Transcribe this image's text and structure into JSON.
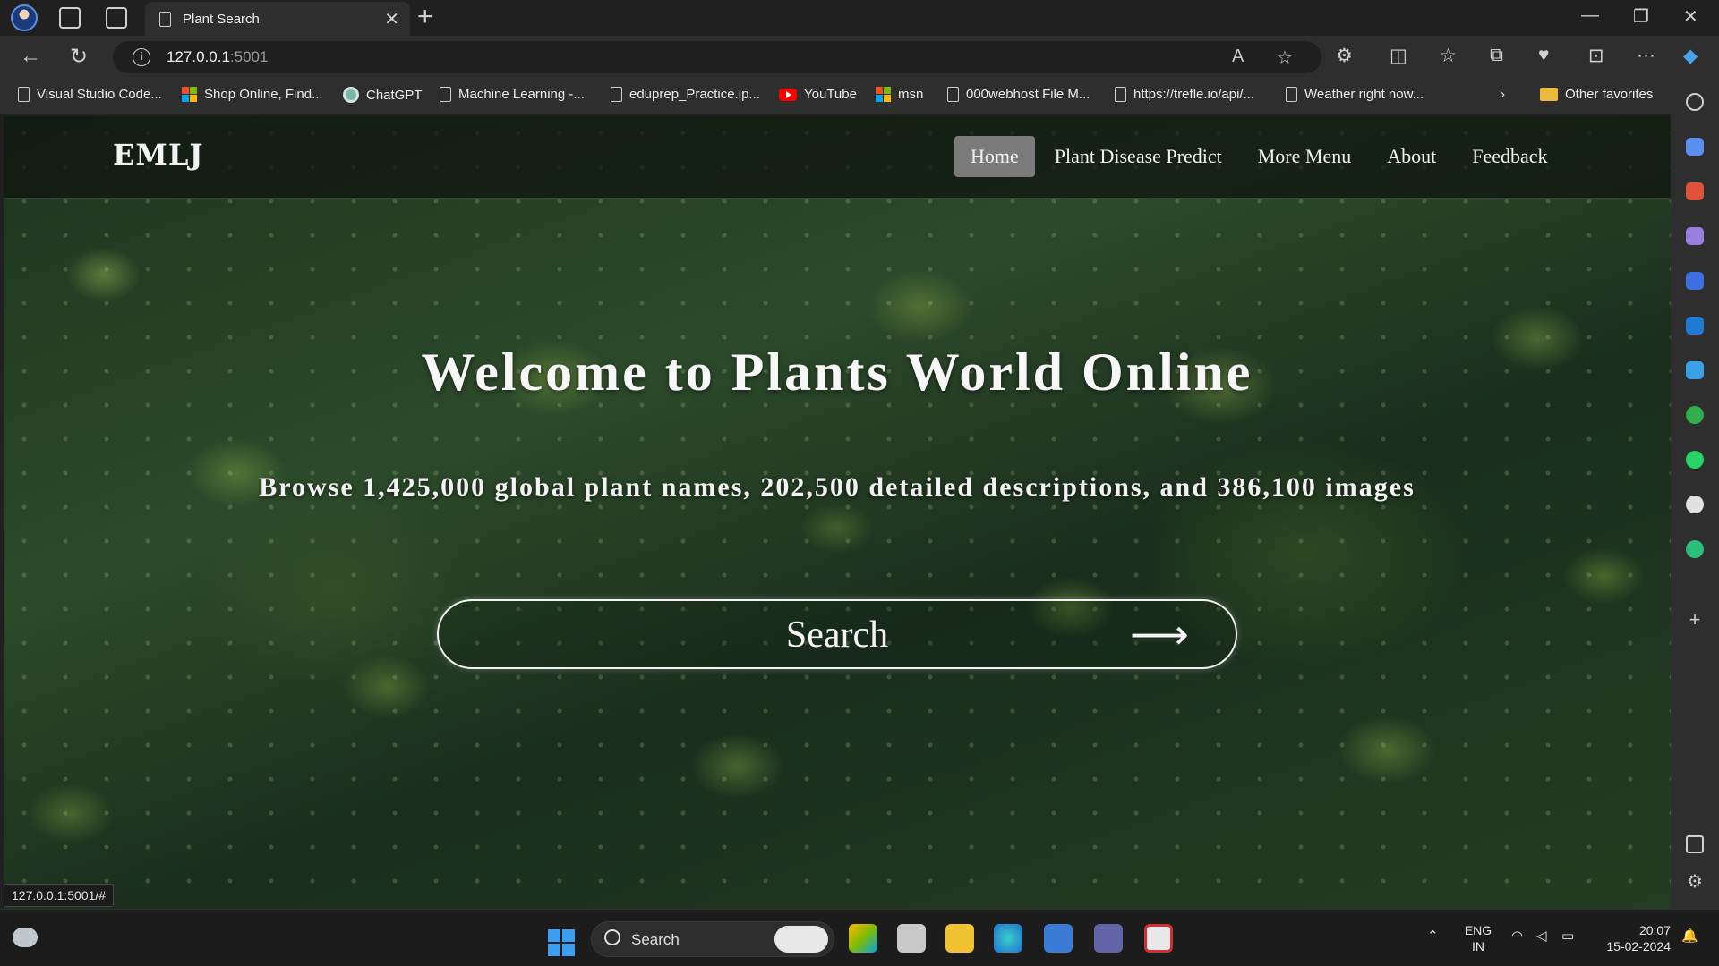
{
  "browser": {
    "tab_title": "Plant Search",
    "url_host": "127.0.0.1",
    "url_port": ":5001",
    "status_url": "127.0.0.1:5001/#"
  },
  "favorites": [
    {
      "label": "Visual Studio Code...",
      "icon": "doc-icon"
    },
    {
      "label": "Shop Online, Find...",
      "icon": "microsoft-icon"
    },
    {
      "label": "ChatGPT",
      "icon": "chatgpt-icon"
    },
    {
      "label": "Machine Learning -...",
      "icon": "doc-icon"
    },
    {
      "label": "eduprep_Practice.ip...",
      "icon": "doc-icon"
    },
    {
      "label": "YouTube",
      "icon": "youtube-icon"
    },
    {
      "label": "msn",
      "icon": "microsoft-icon"
    },
    {
      "label": "000webhost File M...",
      "icon": "doc-icon"
    },
    {
      "label": "https://trefle.io/api/...",
      "icon": "doc-icon"
    },
    {
      "label": "Weather right now...",
      "icon": "doc-icon"
    },
    {
      "label": "Other favorites",
      "icon": "folder-icon"
    }
  ],
  "site": {
    "logo": "EMLJ",
    "nav": [
      "Home",
      "Plant Disease Predict",
      "More Menu",
      "About",
      "Feedback"
    ],
    "active_nav": "Home",
    "hero_title": "Welcome to Plants World Online",
    "hero_subtitle": "Browse 1,425,000 global plant names, 202,500 detailed descriptions, and 386,100 images",
    "search_label": "Search",
    "search_arrow": "⟶"
  },
  "taskbar": {
    "search_label": "Search",
    "lang_line1": "ENG",
    "lang_line2": "IN",
    "time": "20:07",
    "date": "15-02-2024"
  },
  "colors": {
    "nav_active_bg": "#7b7b7b",
    "browser_chrome": "#2e2e2e",
    "taskbar_bg": "#1c1c1c"
  }
}
